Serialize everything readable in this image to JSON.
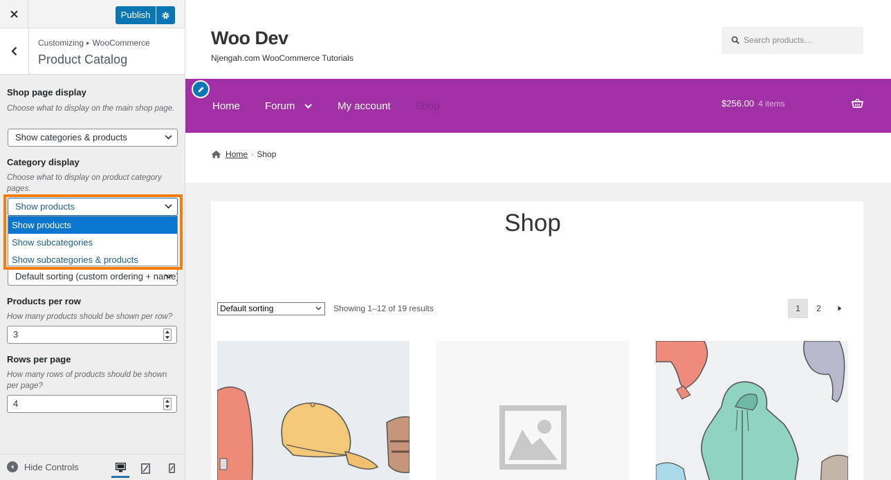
{
  "customizer": {
    "publish_label": "Publish",
    "breadcrumb_root": "Customizing",
    "breadcrumb_sep": "▸",
    "breadcrumb_parent": "WooCommerce",
    "section_title": "Product Catalog",
    "shop_page_display": {
      "title": "Shop page display",
      "description": "Choose what to display on the main shop page.",
      "value": "Show categories & products"
    },
    "category_display": {
      "title": "Category display",
      "description": "Choose what to display on product category pages.",
      "value": "Show products",
      "options": [
        "Show products",
        "Show subcategories",
        "Show subcategories & products"
      ],
      "selected_index": 0
    },
    "default_sorting": {
      "value": "Default sorting (custom ordering + name)"
    },
    "products_per_row": {
      "title": "Products per row",
      "description": "How many products should be shown per row?",
      "value": "3"
    },
    "rows_per_page": {
      "title": "Rows per page",
      "description": "How many rows of products should be shown per page?",
      "value": "4"
    },
    "hide_controls_label": "Hide Controls",
    "colors": {
      "publish": "#0a76b4",
      "highlight": "#f67d0c"
    }
  },
  "site": {
    "title": "Woo Dev",
    "tagline": "Njengah.com WooCommerce Tutorials",
    "search_placeholder": "Search products…",
    "nav": {
      "home": "Home",
      "forum": "Forum",
      "my_account": "My account",
      "shop": "Shop"
    },
    "cart": {
      "total": "$256.00",
      "items": "4 items"
    },
    "breadcrumb": {
      "home": "Home",
      "current": "Shop"
    },
    "page_heading": "Shop",
    "sorting_value": "Default sorting",
    "result_count": "Showing 1–12 of 19 results",
    "pagination": {
      "current": "1",
      "next_page": "2"
    },
    "colors": {
      "nav_bg": "#a12fa6"
    }
  }
}
